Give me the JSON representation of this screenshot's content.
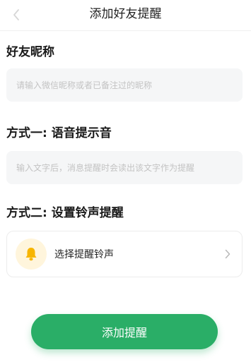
{
  "header": {
    "title": "添加好友提醒"
  },
  "nickname": {
    "label": "好友昵称",
    "placeholder": "请输入微信昵称或者已备注过的昵称",
    "value": ""
  },
  "method_one": {
    "label": "方式一: 语音提示音",
    "placeholder": "输入文字后，消息提醒时会读出该文字作为提醒",
    "value": ""
  },
  "method_two": {
    "label": "方式二: 设置铃声提醒",
    "ringtone_label": "选择提醒铃声"
  },
  "submit": {
    "label": "添加提醒"
  },
  "colors": {
    "accent": "#2aae67",
    "bell": "#f7b500"
  },
  "icons": {
    "back": "chevron-left-icon",
    "bell": "bell-icon",
    "arrow": "chevron-right-icon"
  }
}
